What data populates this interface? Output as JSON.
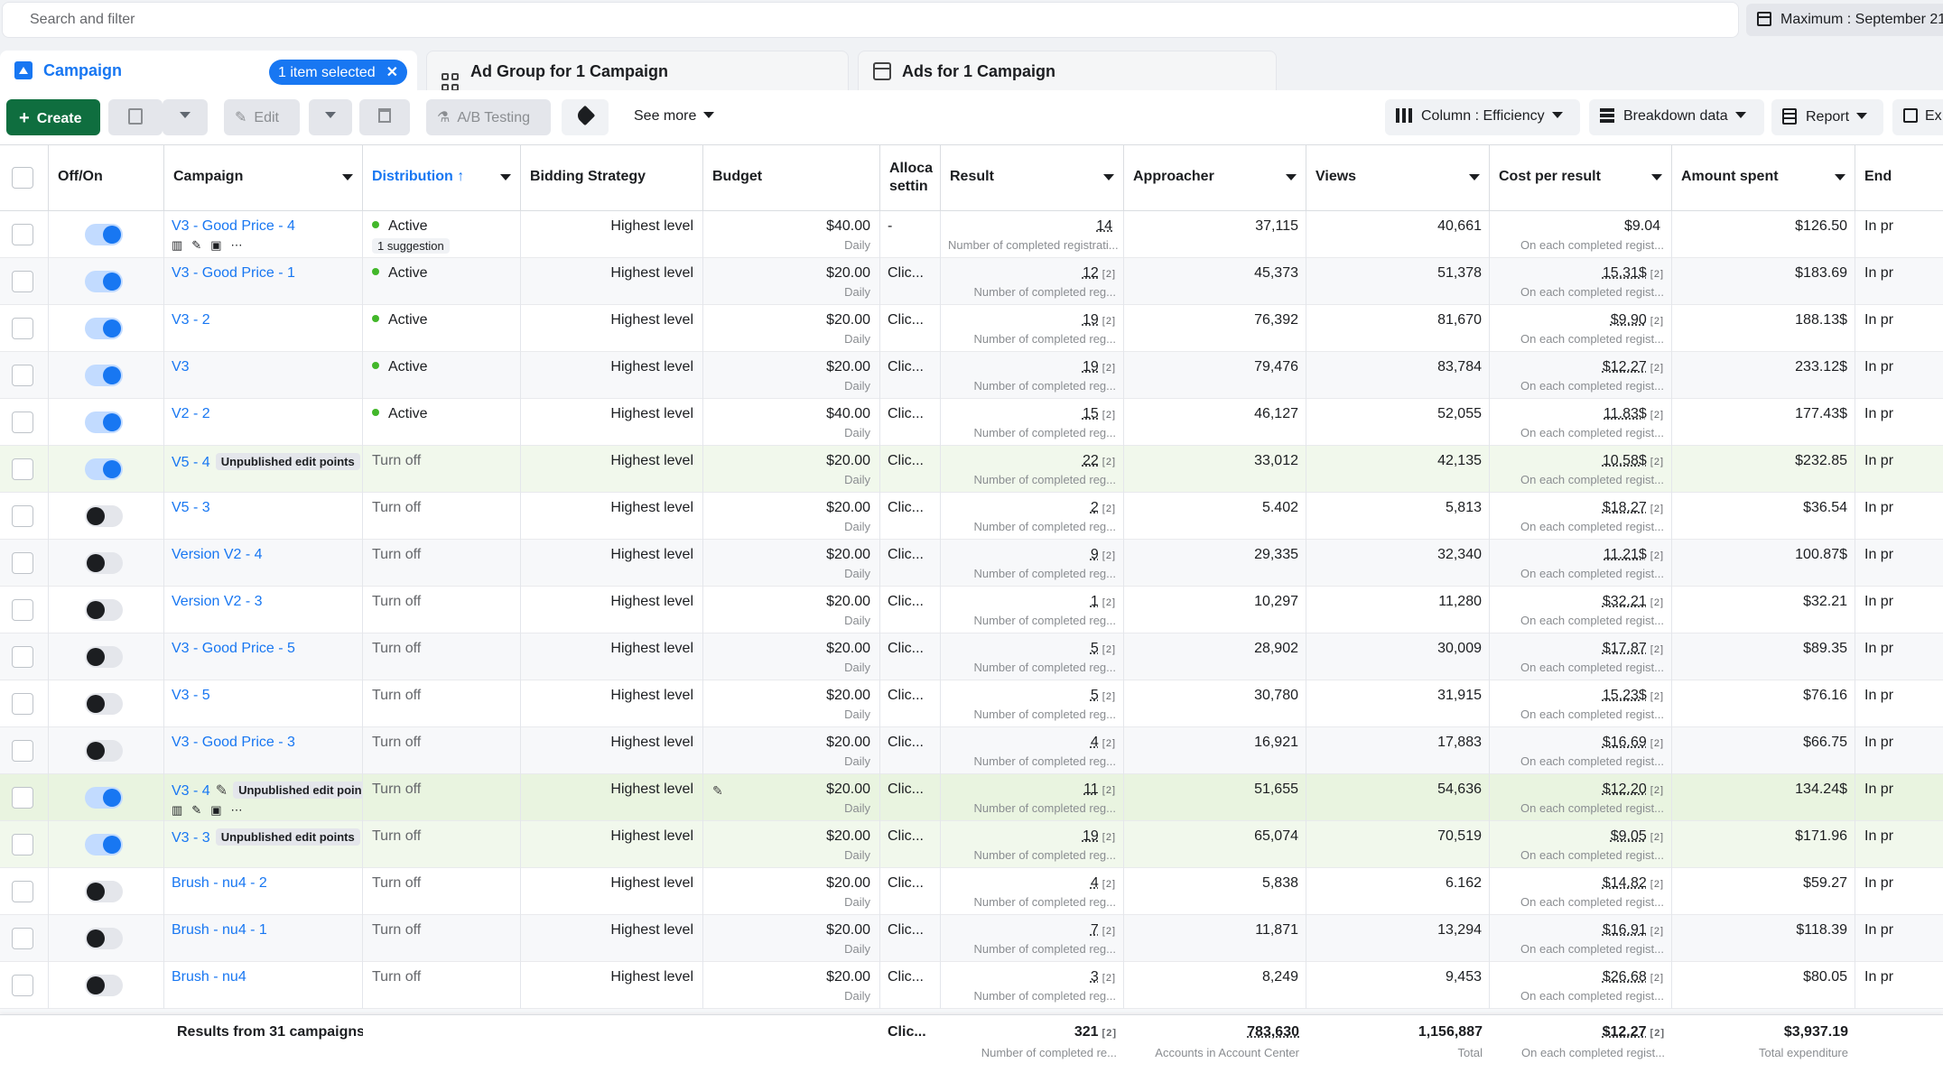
{
  "search": {
    "placeholder": "Search and filter"
  },
  "date_range": {
    "label": "Maximum : September 21"
  },
  "tabs": {
    "campaign": "Campaign",
    "selected_chip": "1 item selected",
    "ad_group": "Ad Group for 1 Campaign",
    "ads": "Ads for 1 Campaign"
  },
  "toolbar": {
    "create": "Create",
    "edit": "Edit",
    "ab_testing": "A/B Testing",
    "see_more": "See more",
    "column": "Column : Efficiency",
    "breakdown": "Breakdown data",
    "report": "Report",
    "export": "Ex"
  },
  "columns": {
    "off_on": "Off/On",
    "campaign": "Campaign",
    "distribution": "Distribution",
    "bidding": "Bidding Strategy",
    "budget": "Budget",
    "alloc": "Alloca settin",
    "result": "Result",
    "approacher": "Approacher",
    "views": "Views",
    "cpr": "Cost per result",
    "spent": "Amount spent",
    "end": "End"
  },
  "rows": [
    {
      "on": true,
      "name": "V3 - Good Price - 4",
      "badge": "",
      "status": "Active",
      "active": true,
      "suggestion": "1 suggestion",
      "bidding": "Highest level",
      "budget": "$40.00",
      "budget_sub": "Daily",
      "alloc": "-",
      "result": "14",
      "result_sup": "",
      "result_sub": "Number of completed registrati...",
      "approacher": "37,115",
      "views": "40,661",
      "cpr": "$9.04",
      "cpr_sup": "",
      "cpr_sub": "On each completed regist...",
      "spent": "$126.50",
      "end": "In pr"
    },
    {
      "on": true,
      "name": "V3 - Good Price - 1",
      "badge": "",
      "status": "Active",
      "active": true,
      "suggestion": "",
      "bidding": "Highest level",
      "budget": "$20.00",
      "budget_sub": "Daily",
      "alloc": "Clic...",
      "result": "12",
      "result_sup": "[2]",
      "result_sub": "Number of completed reg...",
      "approacher": "45,373",
      "views": "51,378",
      "cpr": "15.31$",
      "cpr_sup": "[2]",
      "cpr_sub": "On each completed regist...",
      "spent": "$183.69",
      "end": "In pr"
    },
    {
      "on": true,
      "name": "V3 - 2",
      "badge": "",
      "status": "Active",
      "active": true,
      "suggestion": "",
      "bidding": "Highest level",
      "budget": "$20.00",
      "budget_sub": "Daily",
      "alloc": "Clic...",
      "result": "19",
      "result_sup": "[2]",
      "result_sub": "Number of completed reg...",
      "approacher": "76,392",
      "views": "81,670",
      "cpr": "$9.90",
      "cpr_sup": "[2]",
      "cpr_sub": "On each completed regist...",
      "spent": "188.13$",
      "end": "In pr"
    },
    {
      "on": true,
      "name": "V3",
      "badge": "",
      "status": "Active",
      "active": true,
      "suggestion": "",
      "bidding": "Highest level",
      "budget": "$20.00",
      "budget_sub": "Daily",
      "alloc": "Clic...",
      "result": "19",
      "result_sup": "[2]",
      "result_sub": "Number of completed reg...",
      "approacher": "79,476",
      "views": "83,784",
      "cpr": "$12.27",
      "cpr_sup": "[2]",
      "cpr_sub": "On each completed regist...",
      "spent": "233.12$",
      "end": "In pr"
    },
    {
      "on": true,
      "name": "V2 - 2",
      "badge": "",
      "status": "Active",
      "active": true,
      "suggestion": "",
      "bidding": "Highest level",
      "budget": "$40.00",
      "budget_sub": "Daily",
      "alloc": "Clic...",
      "result": "15",
      "result_sup": "[2]",
      "result_sub": "Number of completed reg...",
      "approacher": "46,127",
      "views": "52,055",
      "cpr": "11.83$",
      "cpr_sup": "[2]",
      "cpr_sub": "On each completed regist...",
      "spent": "177.43$",
      "end": "In pr"
    },
    {
      "on": true,
      "name": "V5 - 4",
      "badge": "Unpublished edit points",
      "status": "Turn off",
      "active": false,
      "suggestion": "",
      "bidding": "Highest level",
      "budget": "$20.00",
      "budget_sub": "Daily",
      "alloc": "Clic...",
      "result": "22",
      "result_sup": "[2]",
      "result_sub": "Number of completed reg...",
      "approacher": "33,012",
      "views": "42,135",
      "cpr": "10.58$",
      "cpr_sup": "[2]",
      "cpr_sub": "On each completed regist...",
      "spent": "$232.85",
      "end": "In pr"
    },
    {
      "on": false,
      "name": "V5 - 3",
      "badge": "",
      "status": "Turn off",
      "active": false,
      "suggestion": "",
      "bidding": "Highest level",
      "budget": "$20.00",
      "budget_sub": "Daily",
      "alloc": "Clic...",
      "result": "2",
      "result_sup": "[2]",
      "result_sub": "Number of completed reg...",
      "approacher": "5.402",
      "views": "5,813",
      "cpr": "$18.27",
      "cpr_sup": "[2]",
      "cpr_sub": "On each completed regist...",
      "spent": "$36.54",
      "end": "In pr"
    },
    {
      "on": false,
      "name": "Version V2 - 4",
      "badge": "",
      "status": "Turn off",
      "active": false,
      "suggestion": "",
      "bidding": "Highest level",
      "budget": "$20.00",
      "budget_sub": "Daily",
      "alloc": "Clic...",
      "result": "9",
      "result_sup": "[2]",
      "result_sub": "Number of completed reg...",
      "approacher": "29,335",
      "views": "32,340",
      "cpr": "11.21$",
      "cpr_sup": "[2]",
      "cpr_sub": "On each completed regist...",
      "spent": "100.87$",
      "end": "In pr"
    },
    {
      "on": false,
      "name": "Version V2 - 3",
      "badge": "",
      "status": "Turn off",
      "active": false,
      "suggestion": "",
      "bidding": "Highest level",
      "budget": "$20.00",
      "budget_sub": "Daily",
      "alloc": "Clic...",
      "result": "1",
      "result_sup": "[2]",
      "result_sub": "Number of completed reg...",
      "approacher": "10,297",
      "views": "11,280",
      "cpr": "$32.21",
      "cpr_sup": "[2]",
      "cpr_sub": "On each completed regist...",
      "spent": "$32.21",
      "end": "In pr"
    },
    {
      "on": false,
      "name": "V3 - Good Price - 5",
      "badge": "",
      "status": "Turn off",
      "active": false,
      "suggestion": "",
      "bidding": "Highest level",
      "budget": "$20.00",
      "budget_sub": "Daily",
      "alloc": "Clic...",
      "result": "5",
      "result_sup": "[2]",
      "result_sub": "Number of completed reg...",
      "approacher": "28,902",
      "views": "30,009",
      "cpr": "$17.87",
      "cpr_sup": "[2]",
      "cpr_sub": "On each completed regist...",
      "spent": "$89.35",
      "end": "In pr"
    },
    {
      "on": false,
      "name": "V3 - 5",
      "badge": "",
      "status": "Turn off",
      "active": false,
      "suggestion": "",
      "bidding": "Highest level",
      "budget": "$20.00",
      "budget_sub": "Daily",
      "alloc": "Clic...",
      "result": "5",
      "result_sup": "[2]",
      "result_sub": "Number of completed reg...",
      "approacher": "30,780",
      "views": "31,915",
      "cpr": "15.23$",
      "cpr_sup": "[2]",
      "cpr_sub": "On each completed regist...",
      "spent": "$76.16",
      "end": "In pr"
    },
    {
      "on": false,
      "name": "V3 - Good Price - 3",
      "badge": "",
      "status": "Turn off",
      "active": false,
      "suggestion": "",
      "bidding": "Highest level",
      "budget": "$20.00",
      "budget_sub": "Daily",
      "alloc": "Clic...",
      "result": "4",
      "result_sup": "[2]",
      "result_sub": "Number of completed reg...",
      "approacher": "16,921",
      "views": "17,883",
      "cpr": "$16.69",
      "cpr_sup": "[2]",
      "cpr_sub": "On each completed regist...",
      "spent": "$66.75",
      "end": "In pr"
    },
    {
      "on": true,
      "name": "V3 - 4",
      "badge": "Unpublished edit poin",
      "status": "Turn off",
      "active": false,
      "suggestion": "",
      "bidding": "Highest level",
      "budget": "$20.00",
      "budget_sub": "Daily",
      "alloc": "Clic...",
      "result": "11",
      "result_sup": "[2]",
      "result_sub": "Number of completed reg...",
      "approacher": "51,655",
      "views": "54,636",
      "cpr": "$12.20",
      "cpr_sup": "[2]",
      "cpr_sub": "On each completed regist...",
      "spent": "134.24$",
      "end": "In pr"
    },
    {
      "on": true,
      "name": "V3 - 3",
      "badge": "Unpublished edit points",
      "status": "Turn off",
      "active": false,
      "suggestion": "",
      "bidding": "Highest level",
      "budget": "$20.00",
      "budget_sub": "Daily",
      "alloc": "Clic...",
      "result": "19",
      "result_sup": "[2]",
      "result_sub": "Number of completed reg...",
      "approacher": "65,074",
      "views": "70,519",
      "cpr": "$9.05",
      "cpr_sup": "[2]",
      "cpr_sub": "On each completed regist...",
      "spent": "$171.96",
      "end": "In pr"
    },
    {
      "on": false,
      "name": "Brush - nu4 - 2",
      "badge": "",
      "status": "Turn off",
      "active": false,
      "suggestion": "",
      "bidding": "Highest level",
      "budget": "$20.00",
      "budget_sub": "Daily",
      "alloc": "Clic...",
      "result": "4",
      "result_sup": "[2]",
      "result_sub": "Number of completed reg...",
      "approacher": "5,838",
      "views": "6.162",
      "cpr": "$14.82",
      "cpr_sup": "[2]",
      "cpr_sub": "On each completed regist...",
      "spent": "$59.27",
      "end": "In pr"
    },
    {
      "on": false,
      "name": "Brush - nu4 - 1",
      "badge": "",
      "status": "Turn off",
      "active": false,
      "suggestion": "",
      "bidding": "Highest level",
      "budget": "$20.00",
      "budget_sub": "Daily",
      "alloc": "Clic...",
      "result": "7",
      "result_sup": "[2]",
      "result_sub": "Number of completed reg...",
      "approacher": "11,871",
      "views": "13,294",
      "cpr": "$16.91",
      "cpr_sup": "[2]",
      "cpr_sub": "On each completed regist...",
      "spent": "$118.39",
      "end": "In pr"
    },
    {
      "on": false,
      "name": "Brush - nu4",
      "badge": "",
      "status": "Turn off",
      "active": false,
      "suggestion": "",
      "bidding": "Highest level",
      "budget": "$20.00",
      "budget_sub": "Daily",
      "alloc": "Clic...",
      "result": "3",
      "result_sup": "[2]",
      "result_sub": "Number of completed reg...",
      "approacher": "8,249",
      "views": "9,453",
      "cpr": "$26.68",
      "cpr_sup": "[2]",
      "cpr_sub": "On each completed regist...",
      "spent": "$80.05",
      "end": "In pr"
    }
  ],
  "footer": {
    "label": "Results from 31 campaigns",
    "alloc": "Clic...",
    "result": "321",
    "result_sup": "[2]",
    "result_sub": "Number of completed re...",
    "approacher": "783,630",
    "approacher_sub": "Accounts in Account Center",
    "views": "1,156,887",
    "views_sub": "Total",
    "cpr": "$12.27",
    "cpr_sup": "[2]",
    "cpr_sub": "On each completed regist...",
    "spent": "$3,937.19",
    "spent_sub": "Total expenditure"
  },
  "colors": {
    "accent": "#1877f2",
    "create": "#0f6e3f",
    "active_dot": "#42b72a"
  }
}
